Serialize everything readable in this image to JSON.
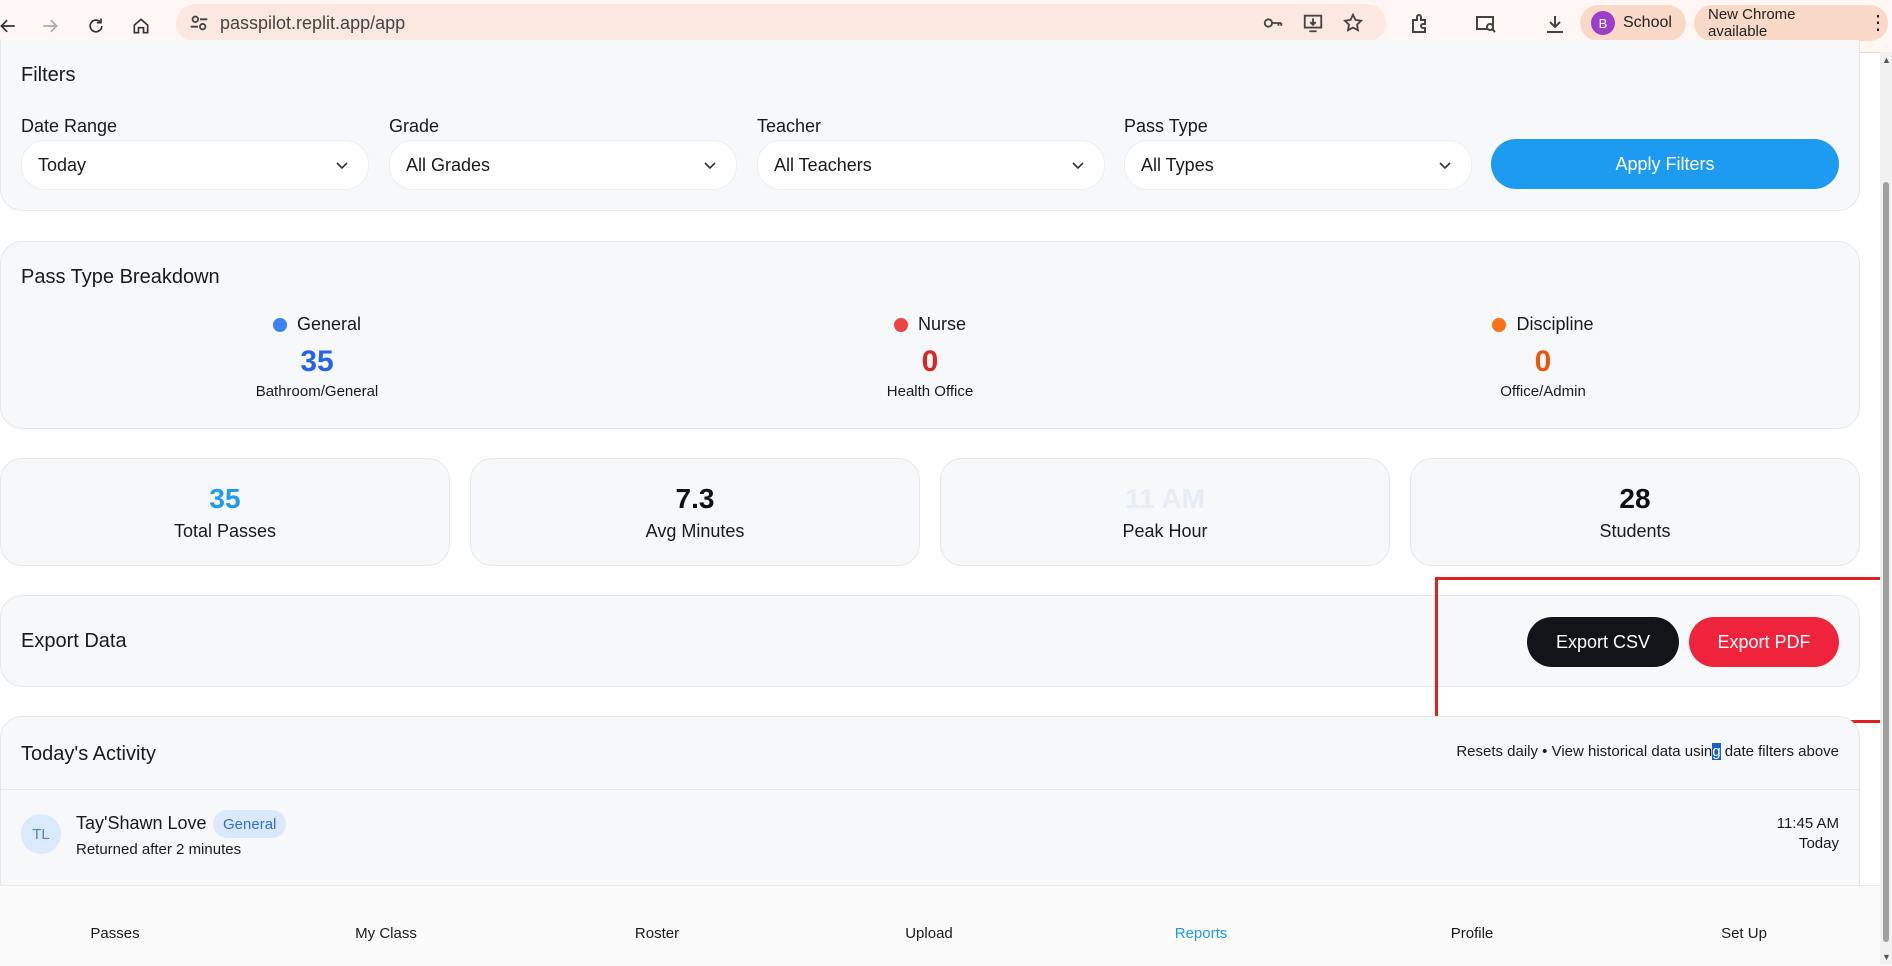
{
  "browser": {
    "url": "passpilot.replit.app/app",
    "profile_initial": "B",
    "profile_name": "School",
    "update_label": "New Chrome available",
    "icons": [
      "back-icon",
      "forward-icon",
      "reload-icon",
      "home-icon",
      "site-info-icon",
      "key-icon",
      "install-icon",
      "star-icon",
      "extensions-icon",
      "media-search-icon",
      "download-icon",
      "menu-icon"
    ]
  },
  "filters": {
    "title": "Filters",
    "fields": [
      {
        "label": "Date Range",
        "value": "Today"
      },
      {
        "label": "Grade",
        "value": "All Grades"
      },
      {
        "label": "Teacher",
        "value": "All Teachers"
      },
      {
        "label": "Pass Type",
        "value": "All Types"
      }
    ],
    "apply_label": "Apply Filters"
  },
  "breakdown": {
    "title": "Pass Type Breakdown",
    "items": [
      {
        "name": "General",
        "count": "35",
        "sub": "Bathroom/General",
        "color": "#3b82f6",
        "num_color": "#2563eb"
      },
      {
        "name": "Nurse",
        "count": "0",
        "sub": "Health Office",
        "color": "#ef4444",
        "num_color": "#dc2626"
      },
      {
        "name": "Discipline",
        "count": "0",
        "sub": "Office/Admin",
        "color": "#f97316",
        "num_color": "#ea580c"
      }
    ]
  },
  "stats": [
    {
      "value": "35",
      "label": "Total Passes",
      "color": "#1d9bf0"
    },
    {
      "value": "7.3",
      "label": "Avg Minutes",
      "color": "#111111"
    },
    {
      "value": "11 AM",
      "label": "Peak Hour",
      "color": "#e6edf5"
    },
    {
      "value": "28",
      "label": "Students",
      "color": "#111111"
    }
  ],
  "export": {
    "title": "Export Data",
    "csv_label": "Export CSV",
    "pdf_label": "Export PDF"
  },
  "activity": {
    "title": "Today's Activity",
    "note_before": "Resets daily • View historical data usin",
    "note_selected": "g",
    "note_after": " date filters above",
    "rows": [
      {
        "initials": "TL",
        "name": "Tay'Shawn Love",
        "badge": "General",
        "detail": "Returned after 2 minutes",
        "time": "11:45 AM",
        "day": "Today"
      }
    ]
  },
  "bottom_nav": {
    "items": [
      "Passes",
      "My Class",
      "Roster",
      "Upload",
      "Reports",
      "Profile",
      "Set Up"
    ],
    "active": "Reports"
  }
}
